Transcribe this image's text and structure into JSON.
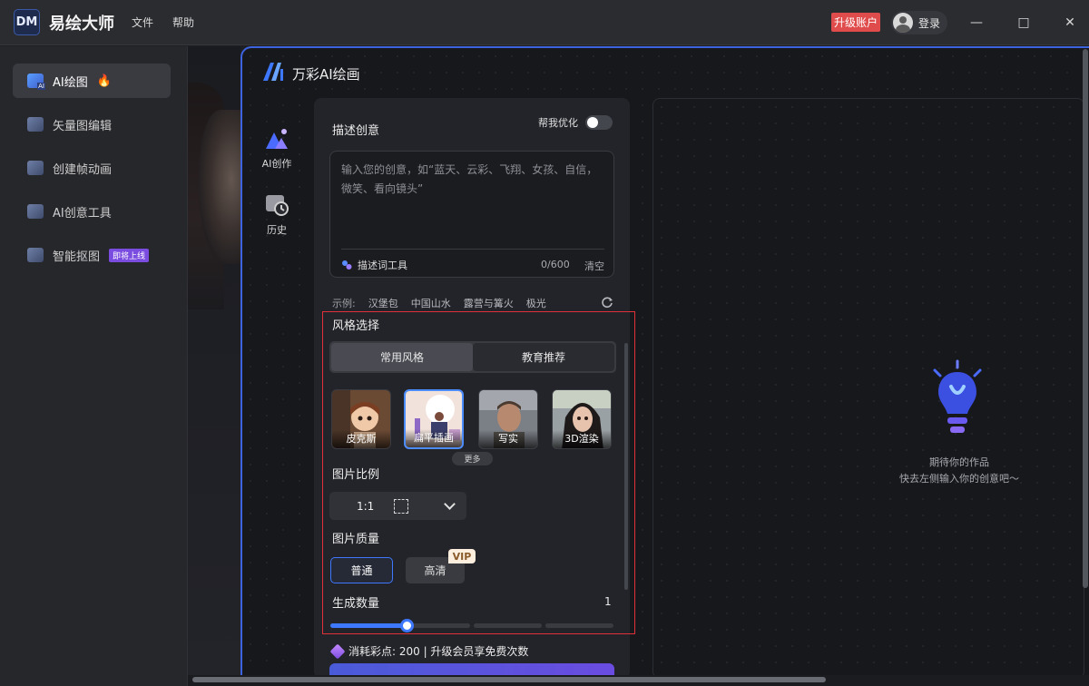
{
  "app": {
    "logo": "DM",
    "title": "易绘大师",
    "menu": [
      "文件",
      "帮助"
    ],
    "upgrade_label": "升级账户",
    "login_label": "登录",
    "window_controls": [
      "—",
      "□",
      "✕"
    ]
  },
  "sidebar": {
    "items": [
      {
        "label": "AI绘图",
        "icon": "ai-image-icon",
        "active": true,
        "extra": "🔥"
      },
      {
        "label": "矢量图编辑",
        "icon": "vector-edit-icon"
      },
      {
        "label": "创建帧动画",
        "icon": "frame-animation-icon"
      },
      {
        "label": "AI创意工具",
        "icon": "ai-creative-tool-icon"
      },
      {
        "label": "智能抠图",
        "icon": "smart-cutout-icon",
        "badge": "即将上线"
      }
    ]
  },
  "panel": {
    "brand_title": "万彩AI绘画",
    "side_tabs": [
      {
        "label": "AI创作",
        "icon": "ai-create-icon"
      },
      {
        "label": "历史",
        "icon": "history-icon"
      }
    ]
  },
  "form": {
    "describe_title": "描述创意",
    "optimize_label": "帮我优化",
    "optimize_on": false,
    "prompt_placeholder": "输入您的创意，如“蓝天、云彩、飞翔、女孩、自信，微笑、看向镜头”",
    "prompt_value": "",
    "prompt_tool_label": "描述词工具",
    "prompt_count": "0/600",
    "clear_label": "清空",
    "examples_label": "示例:",
    "examples": [
      "汉堡包",
      "中国山水",
      "露营与篝火",
      "极光"
    ],
    "style_title": "风格选择",
    "style_tabs": [
      {
        "label": "常用风格",
        "active": true
      },
      {
        "label": "教育推荐",
        "active": false
      }
    ],
    "styles": [
      {
        "label": "皮克斯",
        "selected": false
      },
      {
        "label": "扁平插画",
        "selected": true
      },
      {
        "label": "写实",
        "selected": false
      },
      {
        "label": "3D渲染",
        "selected": false
      }
    ],
    "more_label": "更多",
    "ratio_title": "图片比例",
    "ratio_value": "1:1",
    "quality_title": "图片质量",
    "quality_options": [
      {
        "label": "普通",
        "selected": true
      },
      {
        "label": "高清",
        "selected": false
      }
    ],
    "vip_badge": "VIP",
    "count_title": "生成数量",
    "count_value": "1",
    "count_min": 1,
    "count_max": 4,
    "cost_text": "消耗彩点: 200 | 升级会员享免费次数"
  },
  "preview": {
    "empty_line1": "期待你的作品",
    "empty_line2": "快去左侧输入你的创意吧～"
  },
  "colors": {
    "accent": "#3d78ff",
    "upgrade": "#e04b4b",
    "highlight": "#e0303a",
    "badge_purple": "#7b4ce0"
  }
}
